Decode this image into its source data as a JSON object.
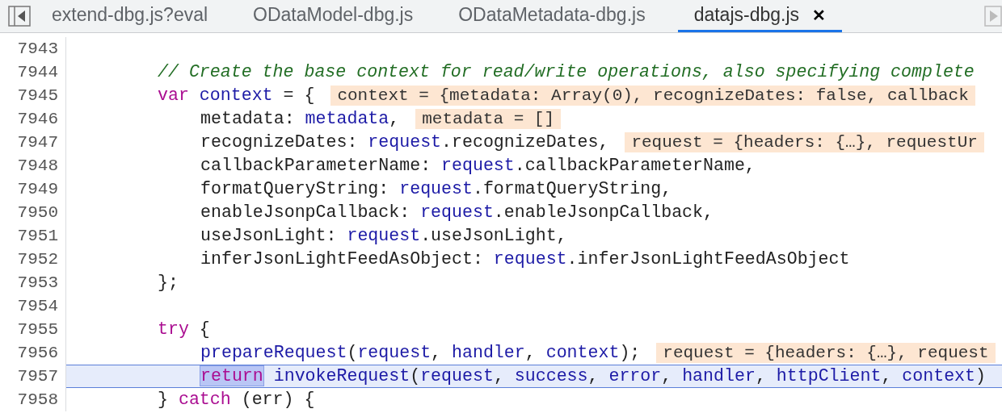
{
  "tabs": [
    {
      "label": "extend-dbg.js?eval",
      "selected": false
    },
    {
      "label": "ODataModel-dbg.js",
      "selected": false
    },
    {
      "label": "ODataMetadata-dbg.js",
      "selected": false
    },
    {
      "label": "datajs-dbg.js",
      "selected": true,
      "close": "✕"
    }
  ],
  "lines": [
    {
      "number": "7943",
      "current": false,
      "kind": "blank"
    },
    {
      "number": "7944",
      "current": false,
      "kind": "outer",
      "tokens": [
        {
          "kind": "comment",
          "text": "// Create the base context for read/write operations, also specifying complete"
        }
      ]
    },
    {
      "number": "7945",
      "current": false,
      "kind": "outer",
      "tokens": [
        {
          "kind": "keyword",
          "text": "var"
        },
        {
          "kind": "variable",
          "text": " context"
        },
        {
          "kind": "plain",
          "text": " = {"
        }
      ],
      "hint": "context = {metadata: Array(0), recognizeDates: false, callback"
    },
    {
      "number": "7946",
      "current": false,
      "kind": "inner",
      "tokens": [
        {
          "kind": "plain",
          "text": "metadata: "
        },
        {
          "kind": "variable",
          "text": "metadata"
        },
        {
          "kind": "plain",
          "text": ","
        }
      ],
      "hint": "metadata = []"
    },
    {
      "number": "7947",
      "current": false,
      "kind": "inner",
      "tokens": [
        {
          "kind": "plain",
          "text": "recognizeDates: "
        },
        {
          "kind": "variable",
          "text": "request"
        },
        {
          "kind": "plain",
          "text": ".recognizeDates,"
        }
      ],
      "hint": "request = {headers: {…}, requestUr"
    },
    {
      "number": "7948",
      "current": false,
      "kind": "inner",
      "tokens": [
        {
          "kind": "plain",
          "text": "callbackParameterName: "
        },
        {
          "kind": "variable",
          "text": "request"
        },
        {
          "kind": "plain",
          "text": ".callbackParameterName,"
        }
      ]
    },
    {
      "number": "7949",
      "current": false,
      "kind": "inner",
      "tokens": [
        {
          "kind": "plain",
          "text": "formatQueryString: "
        },
        {
          "kind": "variable",
          "text": "request"
        },
        {
          "kind": "plain",
          "text": ".formatQueryString,"
        }
      ]
    },
    {
      "number": "7950",
      "current": false,
      "kind": "inner",
      "tokens": [
        {
          "kind": "plain",
          "text": "enableJsonpCallback: "
        },
        {
          "kind": "variable",
          "text": "request"
        },
        {
          "kind": "plain",
          "text": ".enableJsonpCallback,"
        }
      ]
    },
    {
      "number": "7951",
      "current": false,
      "kind": "inner",
      "tokens": [
        {
          "kind": "plain",
          "text": "useJsonLight: "
        },
        {
          "kind": "variable",
          "text": "request"
        },
        {
          "kind": "plain",
          "text": ".useJsonLight,"
        }
      ]
    },
    {
      "number": "7952",
      "current": false,
      "kind": "inner",
      "tokens": [
        {
          "kind": "plain",
          "text": "inferJsonLightFeedAsObject: "
        },
        {
          "kind": "variable",
          "text": "request"
        },
        {
          "kind": "plain",
          "text": ".inferJsonLightFeedAsObject"
        }
      ]
    },
    {
      "number": "7953",
      "current": false,
      "kind": "outer",
      "tokens": [
        {
          "kind": "plain",
          "text": "};"
        }
      ]
    },
    {
      "number": "7954",
      "current": false,
      "kind": "blank"
    },
    {
      "number": "7955",
      "current": false,
      "kind": "outer",
      "tokens": [
        {
          "kind": "keyword",
          "text": "try"
        },
        {
          "kind": "plain",
          "text": " {"
        }
      ]
    },
    {
      "number": "7956",
      "current": false,
      "kind": "inner",
      "tokens": [
        {
          "kind": "variable",
          "text": "prepareRequest"
        },
        {
          "kind": "plain",
          "text": "("
        },
        {
          "kind": "variable",
          "text": "request"
        },
        {
          "kind": "plain",
          "text": ", "
        },
        {
          "kind": "variable",
          "text": "handler"
        },
        {
          "kind": "plain",
          "text": ", "
        },
        {
          "kind": "variable",
          "text": "context"
        },
        {
          "kind": "plain",
          "text": ");"
        }
      ],
      "hint": "request = {headers: {…}, request"
    },
    {
      "number": "7957",
      "current": true,
      "kind": "inner",
      "tokens": [
        {
          "kind": "paused",
          "text": "return"
        },
        {
          "kind": "variable",
          "text": " invokeRequest"
        },
        {
          "kind": "plain",
          "text": "("
        },
        {
          "kind": "variable",
          "text": "request"
        },
        {
          "kind": "plain",
          "text": ", "
        },
        {
          "kind": "variable",
          "text": "success"
        },
        {
          "kind": "plain",
          "text": ", "
        },
        {
          "kind": "variable",
          "text": "error"
        },
        {
          "kind": "plain",
          "text": ", "
        },
        {
          "kind": "variable",
          "text": "handler"
        },
        {
          "kind": "plain",
          "text": ", "
        },
        {
          "kind": "variable",
          "text": "httpClient"
        },
        {
          "kind": "plain",
          "text": ", "
        },
        {
          "kind": "variable",
          "text": "context"
        },
        {
          "kind": "plain",
          "text": ")"
        }
      ]
    },
    {
      "number": "7958",
      "current": false,
      "kind": "outer",
      "tokens": [
        {
          "kind": "plain",
          "text": "} "
        },
        {
          "kind": "keyword",
          "text": "catch"
        },
        {
          "kind": "plain",
          "text": " (err) {"
        }
      ]
    }
  ]
}
